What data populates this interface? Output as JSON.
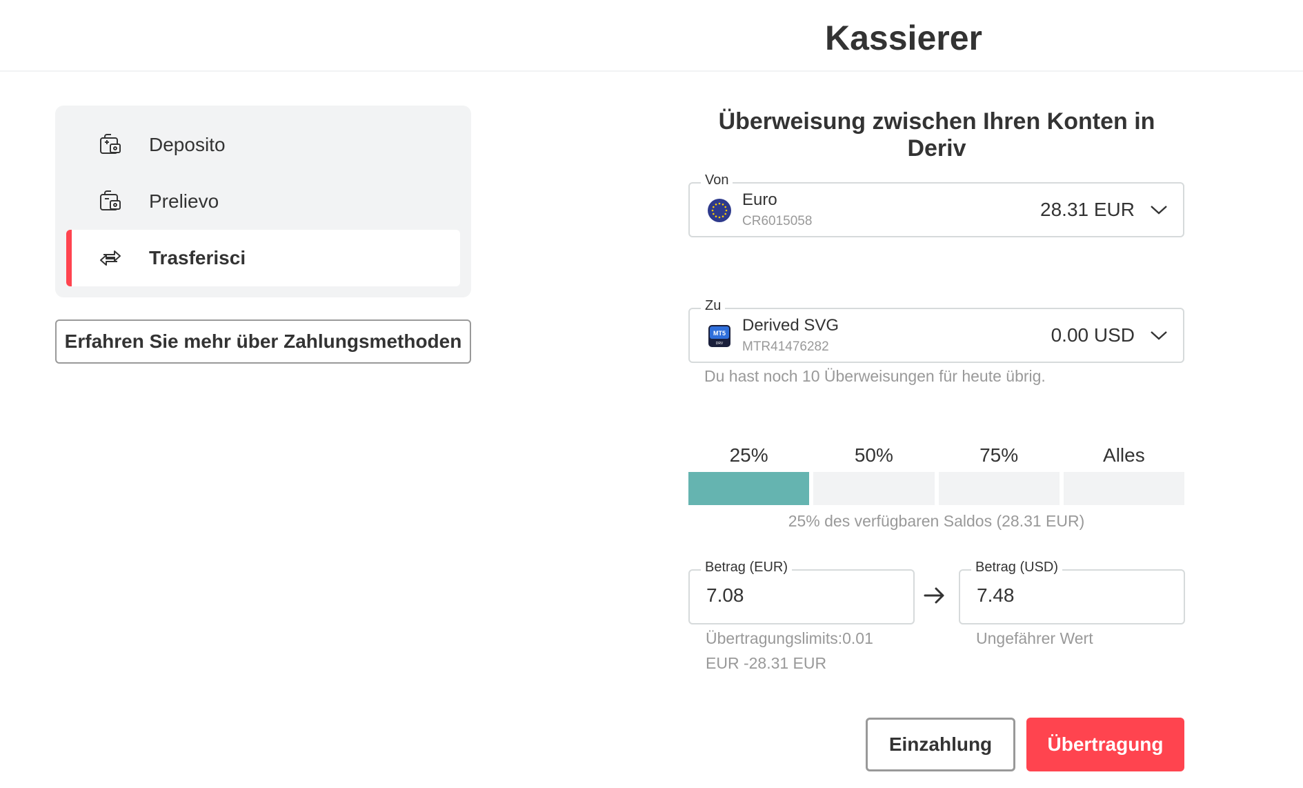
{
  "header": {
    "title": "Kassierer"
  },
  "sidebar": {
    "items": [
      {
        "label": "Deposito",
        "icon": "wallet-plus-icon",
        "active": false
      },
      {
        "label": "Prelievo",
        "icon": "wallet-minus-icon",
        "active": false
      },
      {
        "label": "Trasferisci",
        "icon": "transfer-arrows-icon",
        "active": true
      }
    ],
    "learn_more": "Erfahren Sie mehr über Zahlungsmethoden"
  },
  "transfer": {
    "title": "Überweisung zwischen Ihren Konten in Deriv",
    "from": {
      "legend": "Von",
      "name": "Euro",
      "id": "CR6015058",
      "balance": "28.31 EUR",
      "icon": "eu-flag-icon"
    },
    "to": {
      "legend": "Zu",
      "name": "Derived SVG",
      "id": "MTR41476282",
      "balance": "0.00 USD",
      "icon": "mt5-icon",
      "icon_text": "MT5",
      "icon_subtext": "DRV"
    },
    "remaining_hint": "Du hast noch 10 Überweisungen für heute übrig.",
    "percentages": [
      {
        "label": "25%",
        "selected": true
      },
      {
        "label": "50%",
        "selected": false
      },
      {
        "label": "75%",
        "selected": false
      },
      {
        "label": "Alles",
        "selected": false
      }
    ],
    "percentage_hint": "25% des verfügbaren Saldos (28.31 EUR)",
    "amount_from": {
      "legend": "Betrag (EUR)",
      "value": "7.08",
      "hint_line1": "Übertragungslimits:0.01",
      "hint_line2": "EUR -28.31 EUR"
    },
    "amount_to": {
      "legend": "Betrag (USD)",
      "value": "7.48",
      "hint": "Ungefährer Wert"
    },
    "buttons": {
      "secondary": "Einzahlung",
      "primary": "Übertragung"
    }
  },
  "colors": {
    "accent": "#ff444f",
    "selected_percentage": "#65b4b0",
    "panel_bg": "#f2f3f4"
  }
}
